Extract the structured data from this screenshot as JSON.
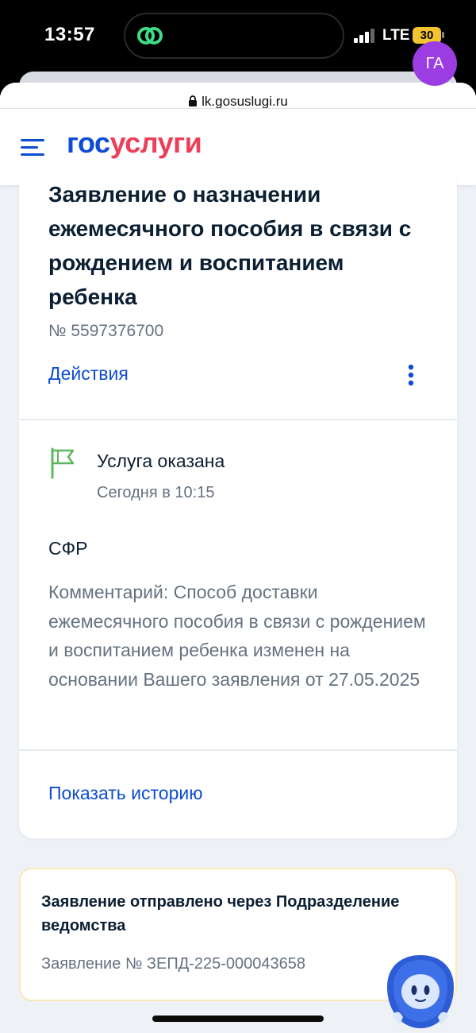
{
  "status_bar": {
    "time": "13:57",
    "network": "LTE",
    "battery": "30"
  },
  "browser": {
    "url": "lk.gosuslugi.ru"
  },
  "header": {
    "logo_part1": "гос",
    "logo_part2": "услуги",
    "avatar_initials": "ГА",
    "colors": {
      "logo_blue": "#0d4cd3",
      "logo_red": "#ee3f58",
      "avatar": "#9b3de3"
    }
  },
  "application": {
    "title": "Заявление о назначении ежемесячного пособия в связи с рождением и воспитанием ребенка",
    "number": "№ 5597376700",
    "actions_label": "Действия",
    "status": "Услуга оказана",
    "status_time": "Сегодня в 10:15",
    "agency": "СФР",
    "comment": "Комментарий: Способ доставки ежемесячного пособия в связи с рождением и воспитанием ребенка изменен на основании Вашего заявления от 27.05.2025",
    "history_label": "Показать историю"
  },
  "info": {
    "title": "Заявление отправлено через Подразделение ведомства",
    "number": "Заявление № ЗЕПД-225-000043658"
  },
  "icons": {
    "menu": "hamburger-menu-icon",
    "flag": "flag-icon",
    "more": "vertical-dots-icon",
    "assistant": "robot-assistant-icon"
  }
}
